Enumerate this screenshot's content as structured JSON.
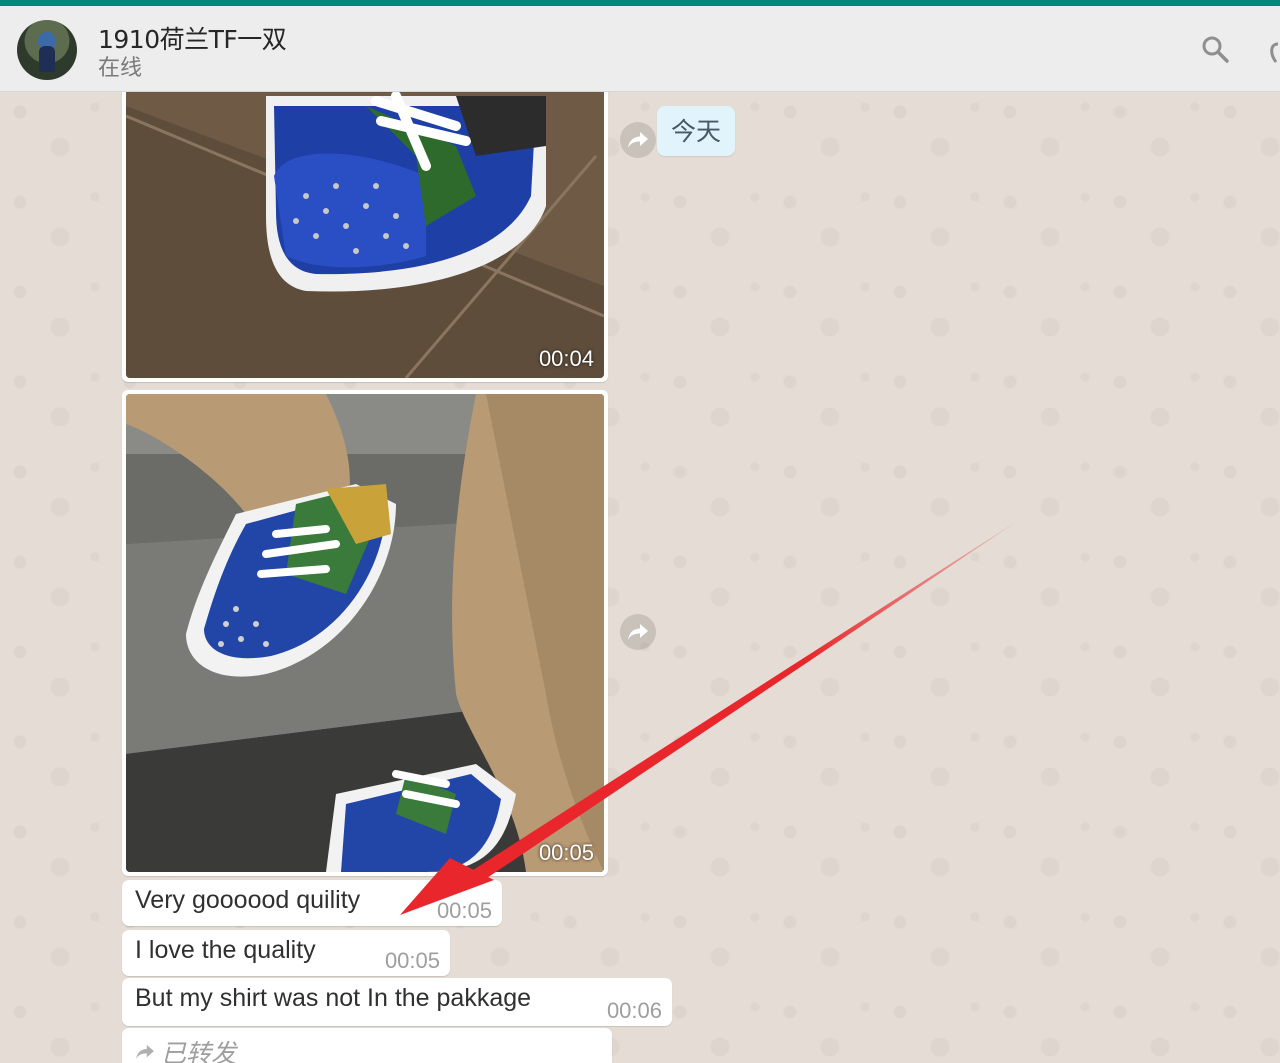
{
  "header": {
    "contact_name": "1910荷兰TF一双",
    "status": "在线"
  },
  "chat": {
    "date_label": "今天",
    "media": [
      {
        "duration": "00:04"
      },
      {
        "duration": "00:05"
      }
    ],
    "messages": [
      {
        "text": "Very goooood quility",
        "time": "00:05"
      },
      {
        "text": "I love the quality",
        "time": "00:05"
      },
      {
        "text": "But my shirt was not In the pakkage",
        "time": "00:06"
      }
    ],
    "forwarded_label": "已转发"
  },
  "colors": {
    "accent": "#00897b",
    "chat_background": "#e5ddd5",
    "date_chip": "#e1f3fb",
    "annotation_arrow": "#e8262b"
  }
}
